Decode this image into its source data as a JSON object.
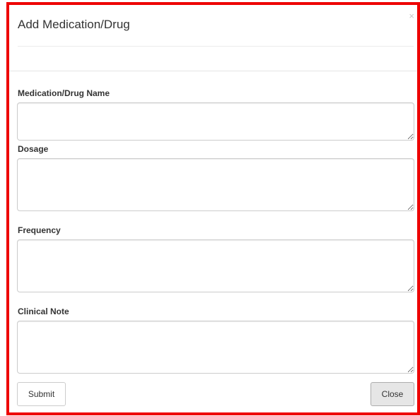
{
  "modal": {
    "title": "Add Medication/Drug",
    "close_glyph": "×"
  },
  "fields": {
    "name": {
      "label": "Medication/Drug Name",
      "value": ""
    },
    "dosage": {
      "label": "Dosage",
      "value": ""
    },
    "frequency": {
      "label": "Frequency",
      "value": ""
    },
    "clinical_note": {
      "label": "Clinical Note",
      "value": ""
    }
  },
  "buttons": {
    "submit_label": "Submit",
    "close_label": "Close"
  },
  "colors": {
    "frame_border": "#ee0000",
    "close_button_bg": "#e6e6e6"
  }
}
